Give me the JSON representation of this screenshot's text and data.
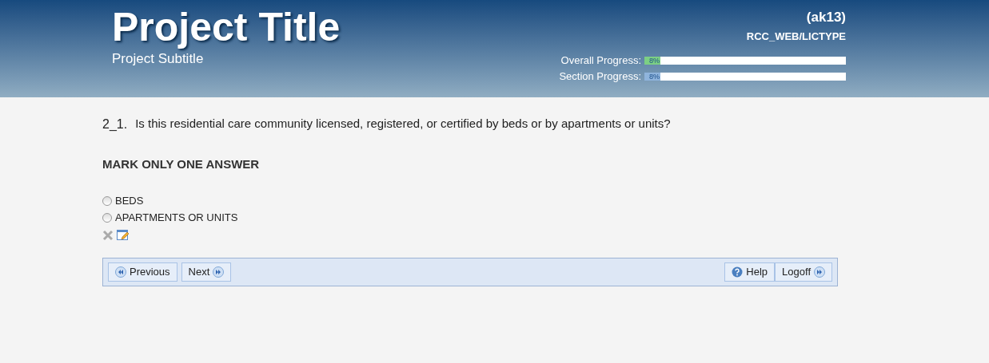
{
  "header": {
    "title": "Project Title",
    "subtitle": "Project Subtitle",
    "user": "(ak13)",
    "section_code": "RCC_WEB/LICTYPE",
    "progress": [
      {
        "label": "Overall Progress:",
        "reading": "8%",
        "level": 0.08,
        "color": "#7ccf84"
      },
      {
        "label": "Section Progress:",
        "reading": "8%",
        "level": 0.08,
        "color": "#8fb4dc"
      }
    ]
  },
  "question": {
    "number": "2_1.",
    "text": "Is this residential care community licensed, registered, or certified by beds or by apartments or units?",
    "instruction": "MARK ONLY ONE ANSWER",
    "options": [
      {
        "label": "BEDS",
        "selected": false
      },
      {
        "label": "APARTMENTS OR UNITS",
        "selected": false
      }
    ]
  },
  "nav": {
    "left": [
      {
        "label": "Previous",
        "kind": "back"
      },
      {
        "label": "Next",
        "kind": "forward"
      }
    ],
    "right": [
      {
        "label": "Help",
        "kind": "help"
      },
      {
        "label": "Logoff",
        "kind": "forward"
      }
    ]
  }
}
